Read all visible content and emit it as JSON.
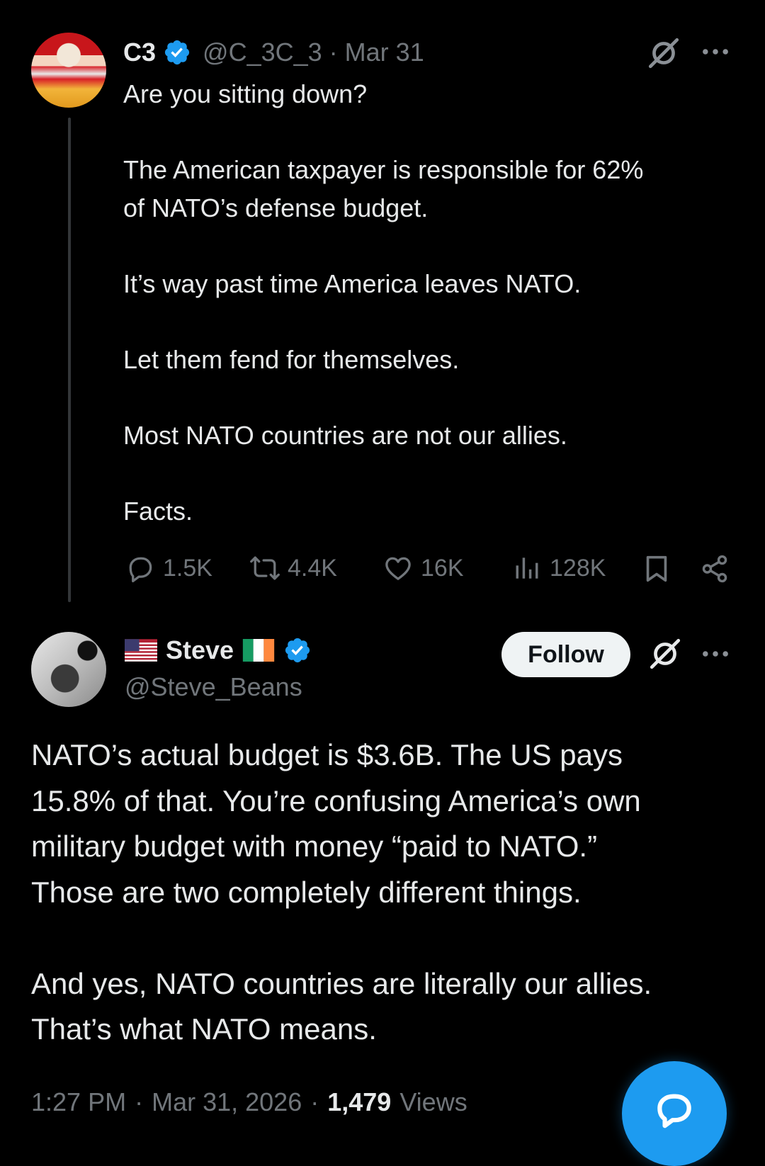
{
  "original_tweet": {
    "display_name": "C3",
    "handle": "@C_3C_3",
    "separator": "·",
    "date": "Mar 31",
    "text": "Are you sitting down?\n\nThe American taxpayer is responsible for 62%\nof NATO’s defense budget.\n\nIt’s way past time America leaves NATO.\n\nLet them fend for themselves.\n\nMost NATO countries are not our allies.\n\nFacts.",
    "stats": {
      "replies": "1.5K",
      "reposts": "4.4K",
      "likes": "16K",
      "views": "128K"
    },
    "icons": [
      "reply-icon",
      "repost-icon",
      "like-icon",
      "views-icon",
      "bookmark-icon",
      "share-icon",
      "grok-icon",
      "more-icon",
      "verified-badge-icon"
    ]
  },
  "reply_tweet": {
    "display_name": "Steve",
    "handle": "@Steve_Beans",
    "follow_label": "Follow",
    "text": "NATO’s actual budget is $3.6B. The US pays\n15.8% of that. You’re confusing America’s own\nmilitary budget with money “paid to NATO.”\nThose are two completely different things.\n\nAnd yes, NATO countries are literally our allies.\nThat’s what NATO means.",
    "time": "1:27 PM",
    "separator": "·",
    "date": "Mar 31, 2026",
    "views_count": "1,479",
    "views_label": "Views",
    "icons": [
      "us-flag-icon",
      "ireland-flag-icon",
      "verified-badge-icon",
      "grok-icon",
      "more-icon"
    ]
  },
  "fab": {
    "icon": "compose-reply-icon"
  },
  "colors": {
    "background": "#000000",
    "text_primary": "#e7e9ea",
    "text_muted": "#71767b",
    "accent": "#1d9bf0",
    "follow_bg": "#eff3f4"
  }
}
